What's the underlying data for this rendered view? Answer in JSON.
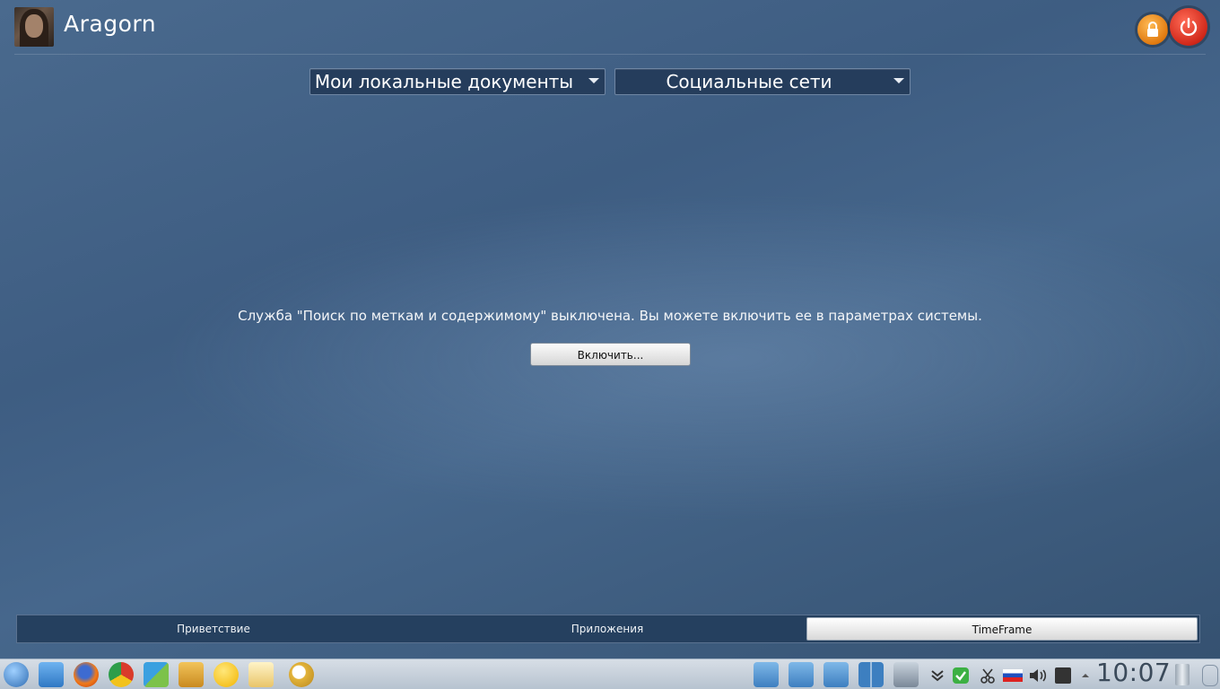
{
  "user": {
    "name": "Aragorn"
  },
  "dropdowns": {
    "left": {
      "selected": "Мои локальные документы"
    },
    "right": {
      "selected": "Социальные сети"
    }
  },
  "main": {
    "message": "Служба \"Поиск по меткам и содержимому\" выключена. Вы можете включить ее в параметрах системы.",
    "enable_button": "Включить..."
  },
  "tabs": [
    {
      "label": "Приветствие",
      "active": false
    },
    {
      "label": "Приложения",
      "active": false
    },
    {
      "label": "TimeFrame",
      "active": true
    }
  ],
  "taskbar": {
    "launchers": [
      "start-menu-icon",
      "file-manager-icon",
      "firefox-icon",
      "chrome-icon",
      "office-calc-icon",
      "notes-icon",
      "chat-icon",
      "mail-icon",
      "search-tool-icon"
    ],
    "tray": [
      "screenshot-icon",
      "screenshot-icon-2",
      "screenshot-icon-3",
      "desktop-grid-icon",
      "system-settings-icon",
      "download-icon",
      "updates-check-icon",
      "clipboard-scissors-icon",
      "russian-flag-icon",
      "volume-icon",
      "printer-icon",
      "tray-expand-icon",
      "trash-icon"
    ],
    "clock": "10:07"
  },
  "colors": {
    "background": "#3e5d82",
    "power": "#d0281a",
    "lock": "#e07a10",
    "tab_bar": "#25405f"
  }
}
